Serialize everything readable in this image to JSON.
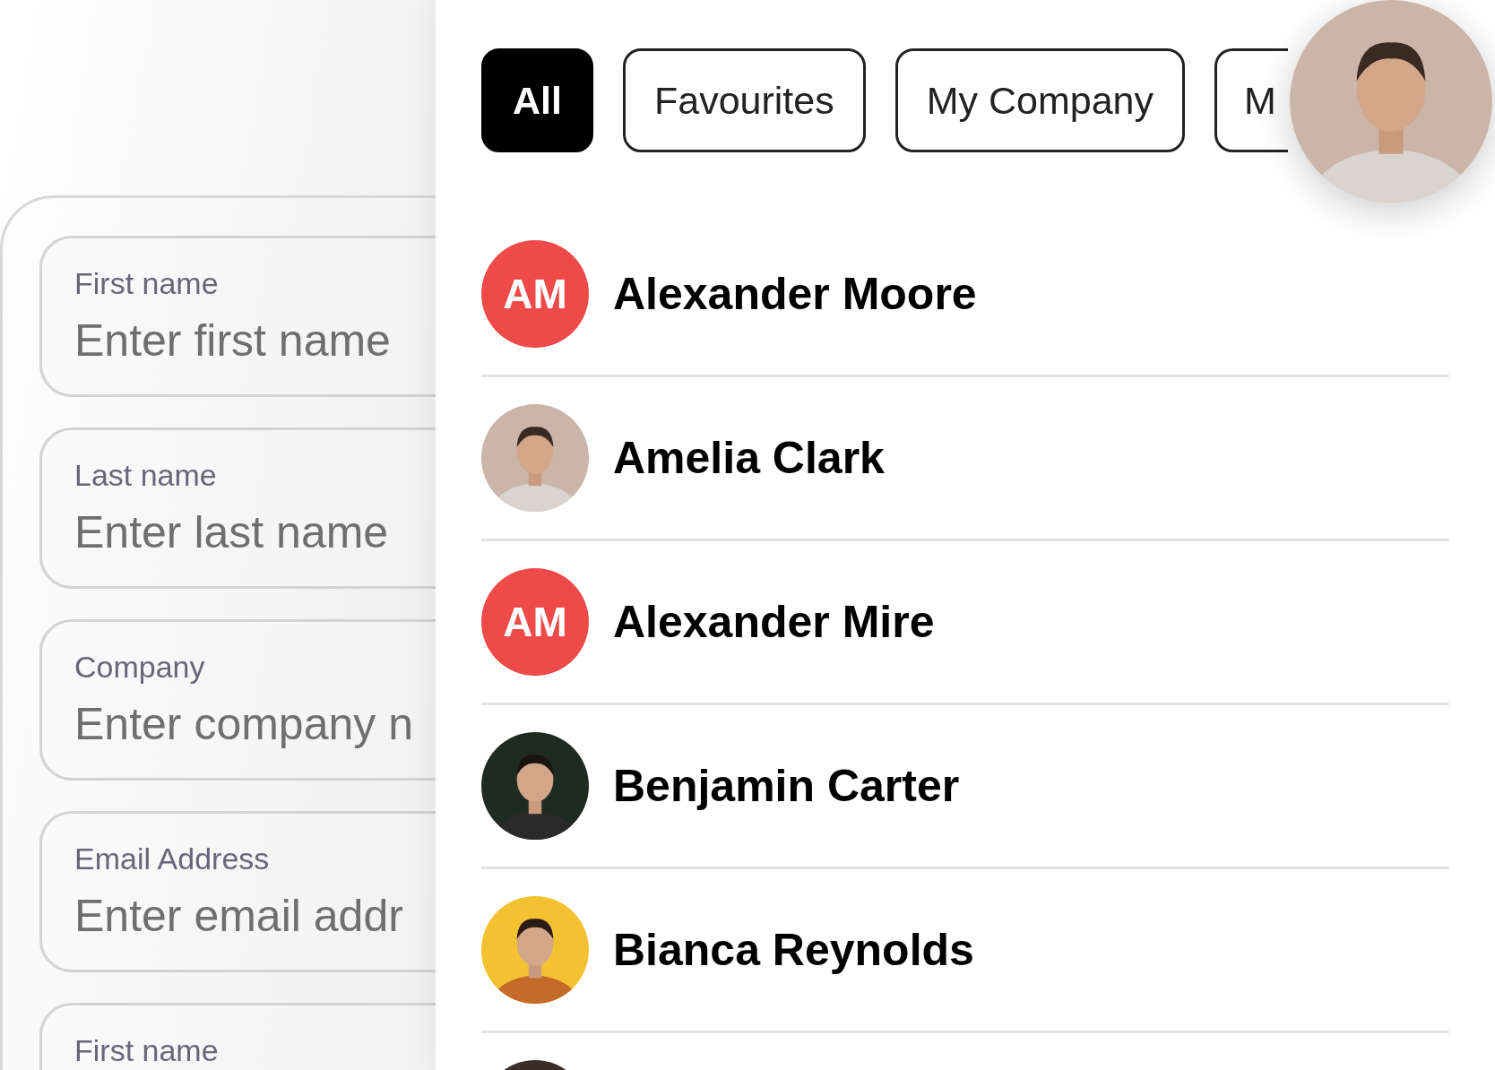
{
  "form": {
    "fields": [
      {
        "label": "First name",
        "placeholder": "Enter first name"
      },
      {
        "label": "Last name",
        "placeholder": "Enter last name"
      },
      {
        "label": "Company",
        "placeholder": "Enter company n"
      },
      {
        "label": "Email Address",
        "placeholder": "Enter email addr"
      },
      {
        "label": "First name"
      }
    ]
  },
  "filters": [
    {
      "label": "All",
      "selected": true
    },
    {
      "label": "Favourites",
      "selected": false
    },
    {
      "label": "My Company",
      "selected": false
    },
    {
      "label": "M",
      "selected": false
    }
  ],
  "floating_avatar": {
    "kind": "picture"
  },
  "contacts": [
    {
      "name": "Alexander Moore",
      "avatar": {
        "kind": "initials",
        "initials": "AM",
        "color": "#ef4a4a"
      }
    },
    {
      "name": "Amelia Clark",
      "avatar": {
        "kind": "picture"
      }
    },
    {
      "name": "Alexander Mire",
      "avatar": {
        "kind": "initials",
        "initials": "AM",
        "color": "#ef4a4a"
      }
    },
    {
      "name": "Benjamin Carter",
      "avatar": {
        "kind": "picture"
      }
    },
    {
      "name": "Bianca Reynolds",
      "avatar": {
        "kind": "picture"
      }
    },
    {
      "avatar": {
        "kind": "picture"
      }
    }
  ]
}
